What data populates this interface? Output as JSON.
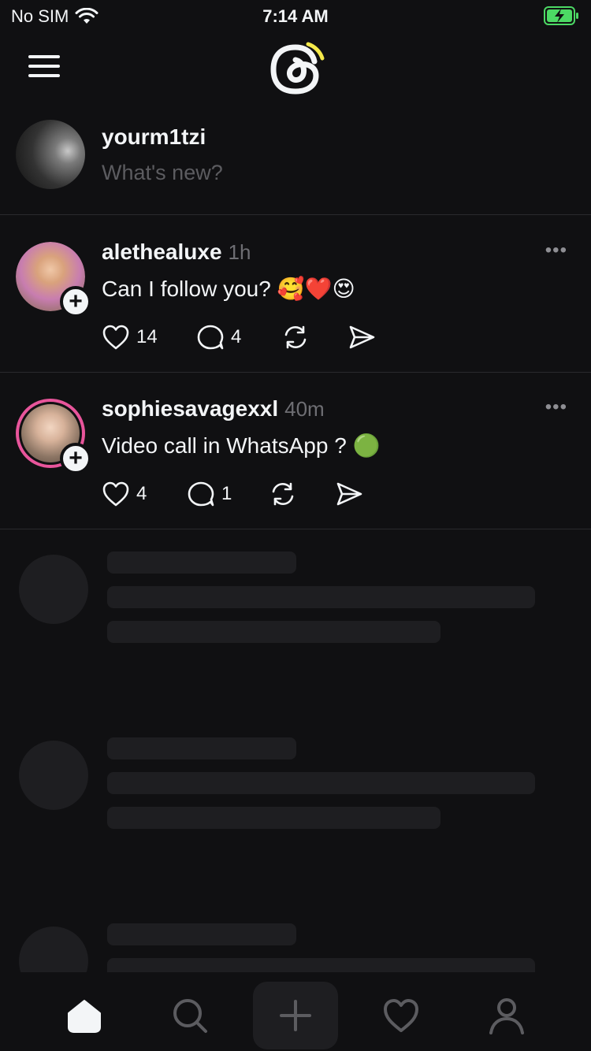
{
  "status_bar": {
    "carrier": "No SIM",
    "time": "7:14 AM"
  },
  "composer": {
    "username": "yourm1tzi",
    "placeholder": "What's new?"
  },
  "posts": [
    {
      "username": "alethealuxe",
      "time": "1h",
      "text": "Can I follow you?",
      "emoji": "🥰❤️😍",
      "likes": "14",
      "replies": "4",
      "more": "•••"
    },
    {
      "username": "sophiesavagexxl",
      "time": "40m",
      "text": "Video call in WhatsApp ?",
      "emoji": "🟢",
      "likes": "4",
      "replies": "1",
      "more": "•••"
    }
  ],
  "tab_bar": {
    "items": [
      "home-icon",
      "search-icon",
      "compose-plus-icon",
      "heart-icon",
      "profile-icon"
    ],
    "active": "home"
  }
}
